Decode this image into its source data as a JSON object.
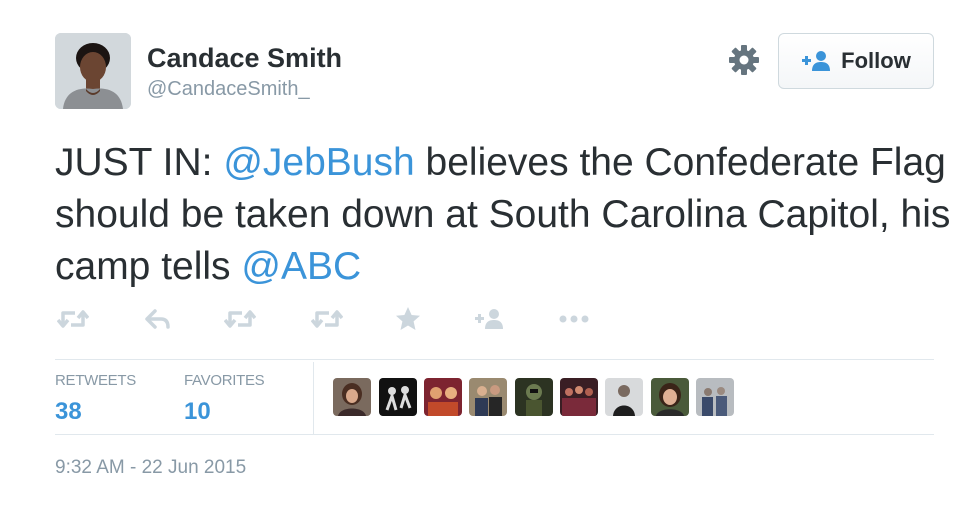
{
  "tweet": {
    "author": {
      "name": "Candace Smith",
      "handle": "@CandaceSmith_"
    },
    "follow_label": "Follow",
    "text_segments": [
      {
        "text": "JUST IN: ",
        "mention": false
      },
      {
        "text": "@JebBush",
        "mention": true
      },
      {
        "text": " believes the Confederate Flag should be taken down at South Carolina Capitol, his camp tells ",
        "mention": false
      },
      {
        "text": "@ABC",
        "mention": true
      }
    ],
    "actions": [
      "retweet-icon",
      "reply-icon",
      "retweet-icon",
      "retweet-icon",
      "favorite-star-icon",
      "follow-person-icon",
      "more-dots-icon"
    ],
    "stats": {
      "retweets_label": "RETWEETS",
      "retweets_value": "38",
      "favorites_label": "FAVORITES",
      "favorites_value": "10"
    },
    "favorited_by_count": 9,
    "timestamp": "9:32 AM - 22 Jun 2015"
  },
  "colors": {
    "link": "#3b94d9",
    "text": "#292f33",
    "muted": "#8899a6",
    "icon": "#ccd6dd",
    "border": "#e1e8ed"
  }
}
